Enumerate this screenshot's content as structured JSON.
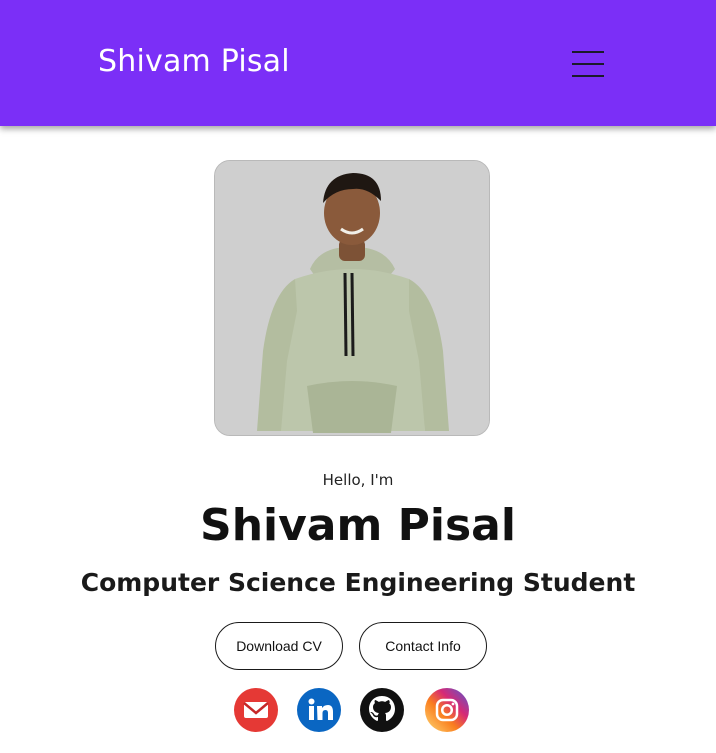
{
  "navbar": {
    "brand": "Shivam Pisal",
    "menu_icon": "hamburger-menu-icon",
    "color": "#7b2ff7"
  },
  "hero": {
    "photo": "profile-photo",
    "greeting": "Hello, I'm",
    "name": "Shivam Pisal",
    "title": "Computer Science Engineering Student",
    "buttons": {
      "download_cv": "Download CV",
      "contact_info": "Contact Info"
    }
  },
  "socials": [
    {
      "icon": "email-icon",
      "color": "#e53935"
    },
    {
      "icon": "linkedin-icon",
      "color": "#0a66c2"
    },
    {
      "icon": "github-icon",
      "color": "#111111"
    },
    {
      "icon": "instagram-icon",
      "color": "#d62976"
    }
  ]
}
